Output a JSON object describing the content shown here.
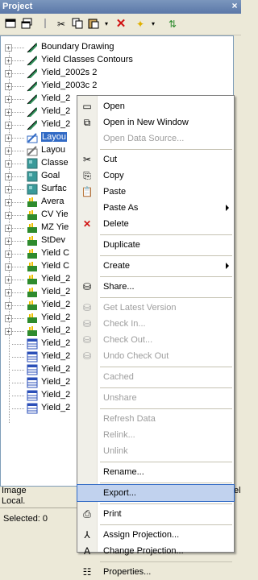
{
  "panel": {
    "title": "Project",
    "close_glyph": "×"
  },
  "toolbar": {
    "icons": [
      "new-window-icon",
      "restore-icon",
      "pin-icon",
      "cut-icon",
      "copy-icon",
      "paste-icon",
      "delete-icon",
      "add-icon",
      "refresh-icon"
    ]
  },
  "tree": {
    "items": [
      {
        "label": "Boundary Drawing",
        "icon": "drawing-icon",
        "color": "#2e8b57"
      },
      {
        "label": "Yield Classes Contours",
        "icon": "drawing-icon",
        "color": "#2e8b57"
      },
      {
        "label": "Yield_2002s 2",
        "icon": "drawing-icon",
        "color": "#2e8b57"
      },
      {
        "label": "Yield_2003c 2",
        "icon": "drawing-icon",
        "color": "#2e8b57"
      },
      {
        "label": "Yield_2",
        "icon": "drawing-icon",
        "color": "#2e8b57"
      },
      {
        "label": "Yield_2",
        "icon": "drawing-icon",
        "color": "#2e8b57"
      },
      {
        "label": "Yield_2",
        "icon": "drawing-icon",
        "color": "#2e8b57"
      },
      {
        "label": "Layou",
        "icon": "layout-icon",
        "color": "#316ac5"
      },
      {
        "label": "Layou",
        "icon": "layout-icon",
        "color": "#707070"
      },
      {
        "label": "Classe",
        "icon": "image-icon",
        "color": "#3a9a9a"
      },
      {
        "label": "Goal",
        "icon": "image-icon",
        "color": "#3a9a9a"
      },
      {
        "label": "Surfac",
        "icon": "image-icon",
        "color": "#3a9a9a"
      },
      {
        "label": "Avera",
        "icon": "table-icon",
        "color": "#2e8b2e"
      },
      {
        "label": "CV Yie",
        "icon": "table-icon",
        "color": "#2e8b2e"
      },
      {
        "label": "MZ Yie",
        "icon": "table-icon",
        "color": "#2e8b2e"
      },
      {
        "label": "StDev",
        "icon": "table-icon",
        "color": "#2e8b2e"
      },
      {
        "label": "Yield C",
        "icon": "table-icon",
        "color": "#2e8b2e"
      },
      {
        "label": "Yield C",
        "icon": "table-icon",
        "color": "#2e8b2e"
      },
      {
        "label": "Yield_2",
        "icon": "table-icon",
        "color": "#2e8b2e"
      },
      {
        "label": "Yield_2",
        "icon": "table-icon",
        "color": "#2e8b2e"
      },
      {
        "label": "Yield_2",
        "icon": "table-icon",
        "color": "#2e8b2e"
      },
      {
        "label": "Yield_2",
        "icon": "table-icon",
        "color": "#2e8b2e"
      },
      {
        "label": "Yield_2",
        "icon": "table-icon",
        "color": "#2e8b2e"
      },
      {
        "label": "Yield_2",
        "icon": "grid-icon",
        "color": "#2b4fb8"
      },
      {
        "label": "Yield_2",
        "icon": "grid-icon",
        "color": "#2b4fb8"
      },
      {
        "label": "Yield_2",
        "icon": "grid-icon",
        "color": "#2b4fb8"
      },
      {
        "label": "Yield_2",
        "icon": "grid-icon",
        "color": "#2b4fb8"
      },
      {
        "label": "Yield_2",
        "icon": "grid-icon",
        "color": "#2b4fb8"
      },
      {
        "label": "Yield_2",
        "icon": "grid-icon",
        "color": "#2b4fb8"
      }
    ],
    "selected_index": 7
  },
  "status": {
    "line1": "Image",
    "line2": "Local.",
    "line1_tail": "el",
    "selected": "Selected: 0"
  },
  "context_menu": {
    "items": [
      {
        "type": "item",
        "label": "Open",
        "icon": "open-icon",
        "glyph": "▭",
        "disabled": false
      },
      {
        "type": "item",
        "label": "Open in New Window",
        "icon": "new-window-icon",
        "glyph": "⧉",
        "disabled": false
      },
      {
        "type": "item",
        "label": "Open Data Source...",
        "icon": "",
        "glyph": "",
        "disabled": true
      },
      {
        "type": "sep"
      },
      {
        "type": "item",
        "label": "Cut",
        "icon": "cut-icon",
        "glyph": "✂",
        "disabled": false
      },
      {
        "type": "item",
        "label": "Copy",
        "icon": "copy-icon",
        "glyph": "⎘",
        "disabled": false
      },
      {
        "type": "item",
        "label": "Paste",
        "icon": "paste-icon",
        "glyph": "📋",
        "disabled": false
      },
      {
        "type": "item",
        "label": "Paste As",
        "icon": "",
        "glyph": "",
        "disabled": false,
        "submenu": true
      },
      {
        "type": "item",
        "label": "Delete",
        "icon": "delete-icon",
        "glyph": "✕",
        "disabled": false,
        "danger": true
      },
      {
        "type": "sep"
      },
      {
        "type": "item",
        "label": "Duplicate",
        "icon": "",
        "glyph": "",
        "disabled": false
      },
      {
        "type": "sep"
      },
      {
        "type": "item",
        "label": "Create",
        "icon": "",
        "glyph": "",
        "disabled": false,
        "submenu": true
      },
      {
        "type": "sep"
      },
      {
        "type": "item",
        "label": "Share...",
        "icon": "share-icon",
        "glyph": "⛁",
        "disabled": false
      },
      {
        "type": "sep"
      },
      {
        "type": "item",
        "label": "Get Latest Version",
        "icon": "version-icon",
        "glyph": "⛁",
        "disabled": true
      },
      {
        "type": "item",
        "label": "Check In...",
        "icon": "checkin-icon",
        "glyph": "⛁",
        "disabled": true
      },
      {
        "type": "item",
        "label": "Check Out...",
        "icon": "checkout-icon",
        "glyph": "⛁",
        "disabled": true
      },
      {
        "type": "item",
        "label": "Undo Check Out",
        "icon": "undo-checkout-icon",
        "glyph": "⛁",
        "disabled": true
      },
      {
        "type": "sep"
      },
      {
        "type": "item",
        "label": "Cached",
        "icon": "",
        "glyph": "",
        "disabled": true
      },
      {
        "type": "sep"
      },
      {
        "type": "item",
        "label": "Unshare",
        "icon": "",
        "glyph": "",
        "disabled": true
      },
      {
        "type": "sep"
      },
      {
        "type": "item",
        "label": "Refresh Data",
        "icon": "",
        "glyph": "",
        "disabled": true
      },
      {
        "type": "item",
        "label": "Relink...",
        "icon": "",
        "glyph": "",
        "disabled": true
      },
      {
        "type": "item",
        "label": "Unlink",
        "icon": "",
        "glyph": "",
        "disabled": true
      },
      {
        "type": "sep"
      },
      {
        "type": "item",
        "label": "Rename...",
        "icon": "",
        "glyph": "",
        "disabled": false
      },
      {
        "type": "sep"
      },
      {
        "type": "item",
        "label": "Export...",
        "icon": "",
        "glyph": "",
        "disabled": false,
        "highlighted": true
      },
      {
        "type": "sep"
      },
      {
        "type": "item",
        "label": "Print",
        "icon": "print-icon",
        "glyph": "⎙",
        "disabled": false
      },
      {
        "type": "sep"
      },
      {
        "type": "item",
        "label": "Assign Projection...",
        "icon": "assign-projection-icon",
        "glyph": "⅄",
        "disabled": false
      },
      {
        "type": "item",
        "label": "Change Projection...",
        "icon": "change-projection-icon",
        "glyph": "A",
        "disabled": false
      },
      {
        "type": "sep"
      },
      {
        "type": "item",
        "label": "Properties...",
        "icon": "properties-icon",
        "glyph": "☷",
        "disabled": false
      }
    ]
  }
}
